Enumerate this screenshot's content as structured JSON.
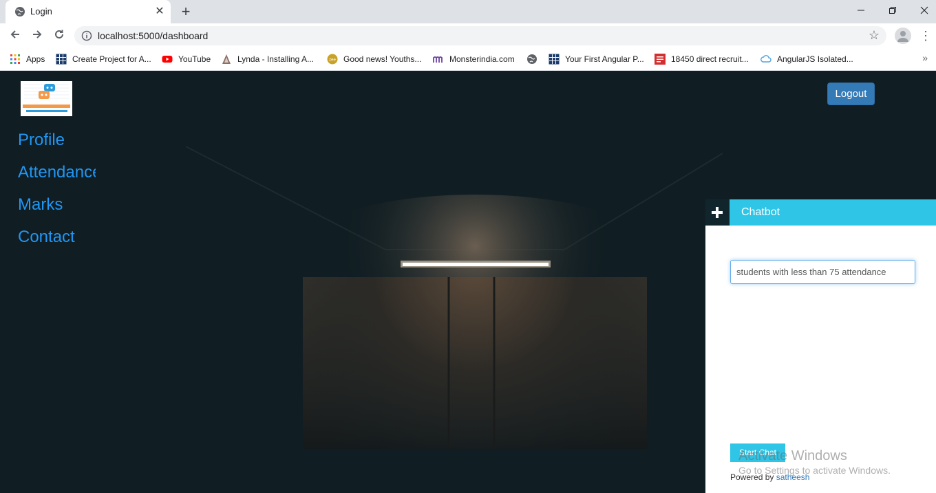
{
  "browser": {
    "tab_title": "Login",
    "tab_close": "✕",
    "new_tab": "+",
    "url": "localhost:5000/dashboard",
    "bookmarks": [
      {
        "label": "Apps",
        "icon": "apps-grid-icon"
      },
      {
        "label": "Create Project for A...",
        "icon": "grid-site-icon"
      },
      {
        "label": "YouTube",
        "icon": "youtube-icon"
      },
      {
        "label": "Lynda - Installing A...",
        "icon": "lynda-icon"
      },
      {
        "label": "Good news! Youths...",
        "icon": "zee-icon"
      },
      {
        "label": "Monsterindia.com",
        "icon": "monster-icon"
      },
      {
        "label": "",
        "icon": "globe-icon"
      },
      {
        "label": "Your First Angular P...",
        "icon": "grid-site-icon"
      },
      {
        "label": "18450 direct recruit...",
        "icon": "toi-icon"
      },
      {
        "label": "AngularJS Isolated...",
        "icon": "cloud-icon"
      }
    ],
    "bookmarks_more": "»"
  },
  "page": {
    "nav": [
      "Profile",
      "Attendance",
      "Marks",
      "Contact"
    ],
    "logout_label": "Logout"
  },
  "chatbot": {
    "title": "Chatbot",
    "input_value": "students with less than 75 attendance",
    "start_label": "Start Chat",
    "powered_prefix": "Powered by",
    "powered_link": "satheesh"
  },
  "watermark": {
    "title": "Activate Windows",
    "subtitle": "Go to Settings to activate Windows."
  },
  "colors": {
    "accent": "#2ec5e6",
    "nav_link": "#2196f3",
    "logout": "#337ab7"
  }
}
